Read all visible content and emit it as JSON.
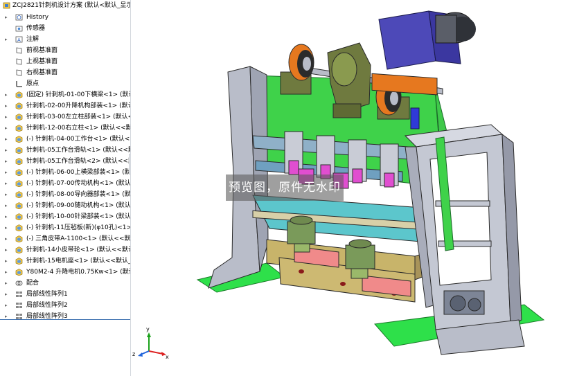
{
  "tree": {
    "root_label": "ZCJ2821针刺机设计方案 (默认<默认_显示",
    "items": [
      {
        "label": "History",
        "icon": "history-icon",
        "expander": true
      },
      {
        "label": "传感器",
        "icon": "sensor-folder-icon",
        "expander": false
      },
      {
        "label": "注解",
        "icon": "annotation-icon",
        "expander": true
      },
      {
        "label": "前视基准面",
        "icon": "plane-icon",
        "expander": false
      },
      {
        "label": "上视基准面",
        "icon": "plane-icon",
        "expander": false
      },
      {
        "label": "右视基准面",
        "icon": "plane-icon",
        "expander": false
      },
      {
        "label": "原点",
        "icon": "origin-icon",
        "expander": false
      },
      {
        "label": "(固定) 针刺机-01-00下横梁<1> (默认<<",
        "icon": "component-icon",
        "expander": true
      },
      {
        "label": "针刺机-02-00升降机构部装<1> (默认<",
        "icon": "component-icon",
        "expander": true
      },
      {
        "label": "针刺机-03-00左立柱部装<1> (默认<默",
        "icon": "component-icon",
        "expander": true
      },
      {
        "label": "针刺机-12-00右立柱<1> (默认<<默认_",
        "icon": "component-icon",
        "expander": true
      },
      {
        "label": "(-) 针刺机-04-00工作台<1> (默认<<默",
        "icon": "component-icon",
        "expander": true
      },
      {
        "label": "针刺机-05工作台滑轨<1> (默认<<默认",
        "icon": "component-icon",
        "expander": true
      },
      {
        "label": "针刺机-05工作台滑轨<2> (默认<<默认",
        "icon": "component-icon",
        "expander": true
      },
      {
        "label": "(-) 针刺机-06-00上横梁部装<1> (默认",
        "icon": "component-icon",
        "expander": true
      },
      {
        "label": "(-) 针刺机-07-00传动机构<1> (默认<",
        "icon": "component-icon",
        "expander": true
      },
      {
        "label": "(-) 针刺机-08-00导向器部装<1> (默认<",
        "icon": "component-icon",
        "expander": true
      },
      {
        "label": "(-) 针刺机-09-00随动机构<1> (默认<<",
        "icon": "component-icon",
        "expander": true
      },
      {
        "label": "(-) 针刺机-10-00针梁部装<1> (默认<<",
        "icon": "component-icon",
        "expander": true
      },
      {
        "label": "(-) 针刺机-11压毡板(新)(φ10孔)<1> (",
        "icon": "component-icon",
        "expander": true
      },
      {
        "label": "(-) 三角皮带A-1100<1> (默认<<默认_",
        "icon": "component-icon",
        "expander": true
      },
      {
        "label": "针刺机-14小皮带轮<1> (默认<<默认",
        "icon": "component-icon",
        "expander": true
      },
      {
        "label": "针刺机-15电机座<1> (默认<<默认_",
        "icon": "component-icon",
        "expander": true
      },
      {
        "label": "Y80M2-4 升降电机0.75Kw<1> (默认",
        "icon": "component-icon",
        "expander": true
      },
      {
        "label": "配合",
        "icon": "mates-icon",
        "expander": true
      },
      {
        "label": "局部线性阵列1",
        "icon": "pattern-icon",
        "expander": true
      },
      {
        "label": "局部线性阵列2",
        "icon": "pattern-icon",
        "expander": true
      },
      {
        "label": "局部线性阵列3",
        "icon": "pattern-icon",
        "expander": true
      }
    ]
  },
  "viewport": {
    "watermark": "预览图，原件无水印",
    "triad": {
      "x": "x",
      "y": "y",
      "z": "z"
    }
  },
  "colors": {
    "frame_gray": "#b9bdc9",
    "frame_outline": "#2a2a2a",
    "base_green": "#2ee04a",
    "panel_green": "#3fd24a",
    "motor_blue": "#4d49b8",
    "gearbox_olive": "#6f7a3f",
    "pulley_orange": "#e6781f",
    "work_teal": "#5cc6cc",
    "pad_pink": "#f08a8a",
    "bar_khaki": "#c8b46a",
    "needle_magenta": "#e04ed0"
  }
}
